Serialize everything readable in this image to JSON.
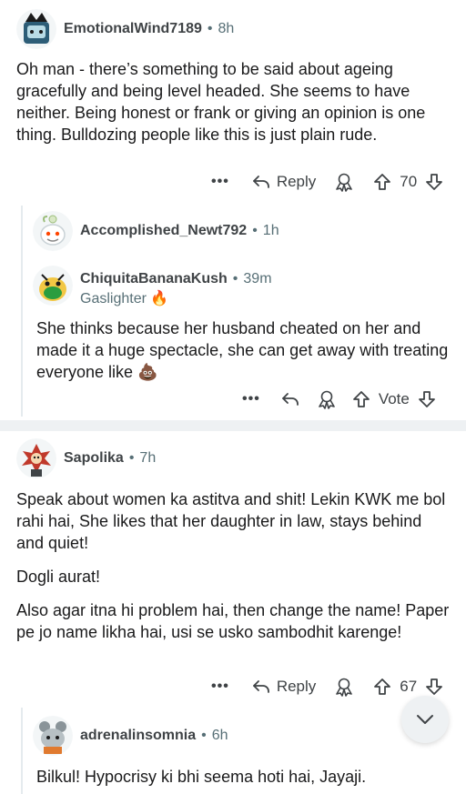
{
  "comments": [
    {
      "username": "EmotionalWind7189",
      "time": "8h",
      "paragraphs": [
        "Oh man - there’s something to be said about ageing gracefully and being level headed. She seems to have neither. Being honest or frank or giving an opinion is one thing. Bulldozing people like this is just plain rude."
      ],
      "reply_label": "Reply",
      "votes": "70"
    },
    {
      "username": "Accomplished_Newt792",
      "time": "1h"
    },
    {
      "username": "ChiquitaBananaKush",
      "time": "39m",
      "flair": "Gaslighter 🔥",
      "paragraphs": [
        "She thinks because her husband cheated on her and made it a huge spectacle, she can get away with treating everyone like 💩"
      ],
      "vote_label": "Vote"
    },
    {
      "username": "Sapolika",
      "time": "7h",
      "paragraphs": [
        "Speak about women ka astitva and shit! Lekin KWK me bol rahi hai, She likes that her daughter in law, stays behind and quiet!",
        "Dogli aurat!",
        "Also agar itna hi problem hai, then change the name! Paper pe jo name likha hai, usi se usko sambodhit karenge!"
      ],
      "reply_label": "Reply",
      "votes": "67"
    },
    {
      "username": "adrenalinsomnia",
      "time": "6h",
      "paragraphs": [
        "Bilkul! Hypocrisy ki bhi seema hoti hai, Jayaji."
      ]
    }
  ],
  "separator_dot": "•",
  "more_label": "•••",
  "colors": {
    "text": "#1a1a1b",
    "meta": "#576f76",
    "thread_line": "#e5ebee",
    "separator": "#eef1f3"
  }
}
